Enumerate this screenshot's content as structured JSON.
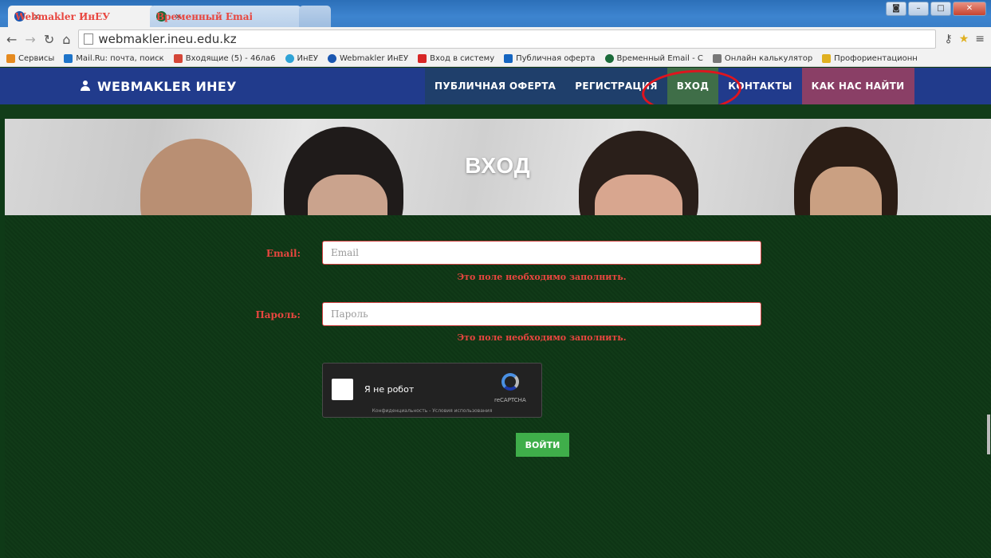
{
  "browser": {
    "tabs": [
      {
        "label": "Webmakler ИнЕУ",
        "active": true,
        "favicon_color": "#1a56b0"
      },
      {
        "label": "Временный Email - Однол",
        "active": false,
        "favicon_color": "#1b6b3a"
      }
    ],
    "url": "webmakler.ineu.edu.kz",
    "bookmarks": [
      {
        "label": "Сервисы",
        "icon": "apps-grid-icon",
        "color": "#e58a1f"
      },
      {
        "label": "Mail.Ru: почта, поиск",
        "icon": "mailru-icon",
        "color": "#1e74c9"
      },
      {
        "label": "Входящие (5) - 46ла6",
        "icon": "gmail-icon",
        "color": "#d44638"
      },
      {
        "label": "ИнЕУ",
        "icon": "ineu-icon",
        "color": "#2fa3d6"
      },
      {
        "label": "Webmakler ИнЕУ",
        "icon": "webmakler-icon",
        "color": "#1a56b0"
      },
      {
        "label": "Вход в систему",
        "icon": "login-red-icon",
        "color": "#d72626"
      },
      {
        "label": "Публичная оферта",
        "icon": "l-icon",
        "color": "#1565c0"
      },
      {
        "label": "Временный Email - С",
        "icon": "tempmail-icon",
        "color": "#1b6b3a"
      },
      {
        "label": "Онлайн калькулятор",
        "icon": "calculator-icon",
        "color": "#777777"
      },
      {
        "label": "Профориентационн",
        "icon": "career-icon",
        "color": "#e0b020"
      }
    ]
  },
  "site": {
    "brand": "WEBMAKLER ИНЕУ",
    "nav": [
      {
        "key": "oferta",
        "label": "ПУБЛИЧНАЯ ОФЕРТА"
      },
      {
        "key": "reg",
        "label": "РЕГИСТРАЦИЯ"
      },
      {
        "key": "login",
        "label": "ВХОД"
      },
      {
        "key": "contacts",
        "label": "КОНТАКТЫ"
      },
      {
        "key": "find",
        "label": "КАК НАС НАЙТИ"
      }
    ],
    "hero_title": "ВХОД"
  },
  "form": {
    "email_label": "Email:",
    "email_placeholder": "Email",
    "email_error": "Это поле необходимо заполнить.",
    "password_label": "Пароль:",
    "password_placeholder": "Пароль",
    "password_error": "Это поле необходимо заполнить.",
    "captcha_label": "Я не робот",
    "captcha_brand": "reCAPTCHA",
    "captcha_terms": "Конфиденциальность - Условия использования",
    "submit_label": "ВОЙТИ"
  },
  "colors": {
    "nav_bg": "#213b8c",
    "accent_error": "#e8463f",
    "submit_bg": "#3fae4a",
    "annotation_circle": "#e0141e"
  }
}
